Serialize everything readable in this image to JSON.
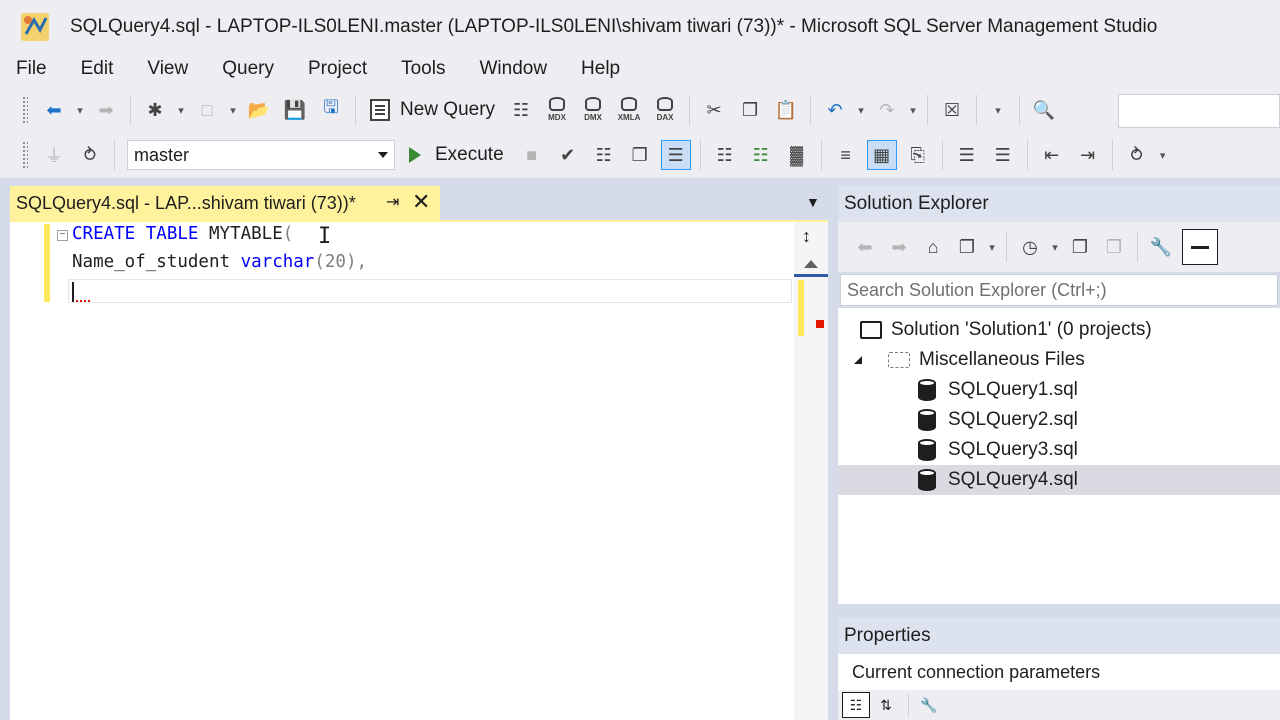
{
  "window": {
    "title": "SQLQuery4.sql - LAPTOP-ILS0LENI.master (LAPTOP-ILS0LENI\\shivam tiwari (73))* - Microsoft SQL Server Management Studio"
  },
  "menu": [
    "File",
    "Edit",
    "View",
    "Query",
    "Project",
    "Tools",
    "Window",
    "Help"
  ],
  "toolbar1": {
    "new_query_label": "New Query",
    "mdx_label": "MDX",
    "dmx_label": "DMX",
    "xmla_label": "XMLA",
    "dax_label": "DAX"
  },
  "toolbar2": {
    "database": "master",
    "execute_label": "Execute"
  },
  "editor": {
    "tab_title": "SQLQuery4.sql - LAP...shivam tiwari (73))*",
    "lines": [
      {
        "kw1": "CREATE",
        "kw2": "TABLE",
        "name": "MYTABLE",
        "paren": "("
      },
      {
        "col": "Name_of_student",
        "type": "varchar",
        "args": "(20),"
      }
    ]
  },
  "solution_explorer": {
    "title": "Solution Explorer",
    "search_placeholder": "Search Solution Explorer (Ctrl+;)",
    "solution_label": "Solution 'Solution1' (0 projects)",
    "folder_label": "Miscellaneous Files",
    "files": [
      "SQLQuery1.sql",
      "SQLQuery2.sql",
      "SQLQuery3.sql",
      "SQLQuery4.sql"
    ],
    "selected_file": "SQLQuery4.sql"
  },
  "properties": {
    "title": "Properties",
    "object_label": "Current connection parameters"
  },
  "colors": {
    "tab_active": "#fff29d",
    "keyword": "#0000ff",
    "workspace_bg": "#d6dbe9"
  }
}
